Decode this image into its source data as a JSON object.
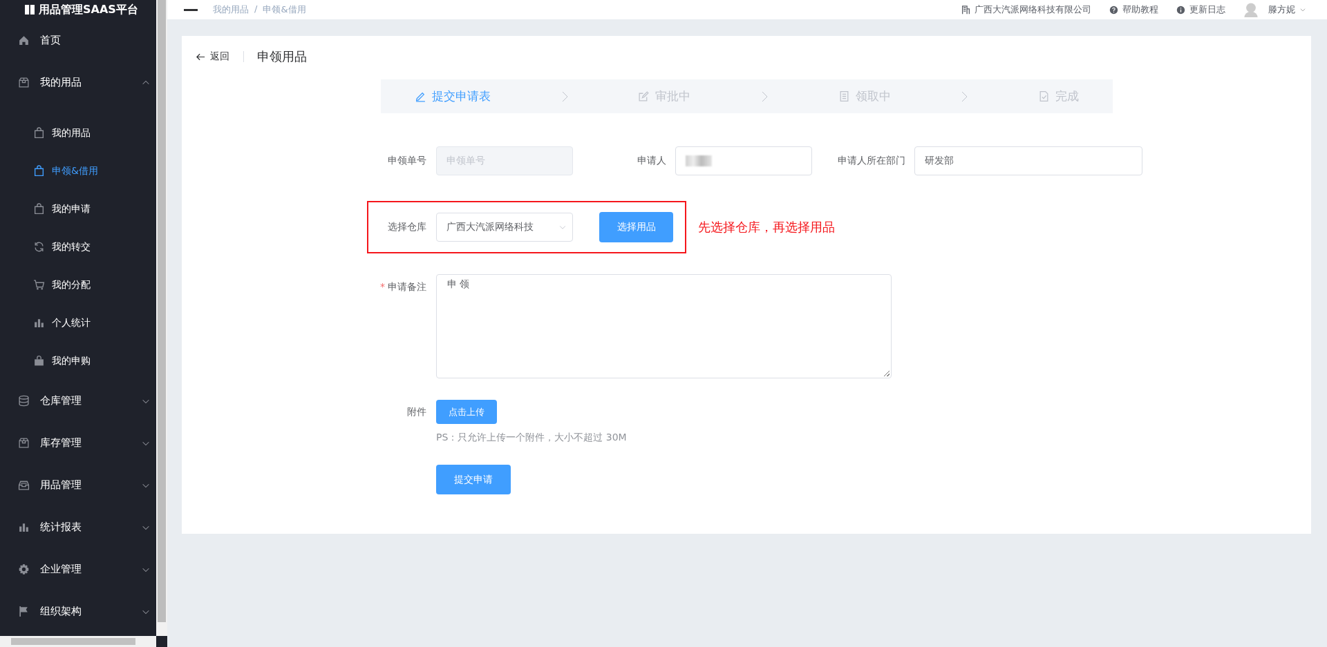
{
  "app": {
    "logo": "用品管理SAAS平台"
  },
  "header": {
    "breadcrumb": [
      "我的用品",
      "申领&借用"
    ],
    "separator": "/",
    "company": "广西大汽派网络科技有限公司",
    "links": [
      {
        "label": "帮助教程",
        "kind": "help"
      },
      {
        "label": "更新日志",
        "kind": "info"
      }
    ],
    "user": "滕方妮"
  },
  "sidebar": {
    "items": [
      {
        "label": "首页",
        "kind": "home"
      },
      {
        "label": "我的用品",
        "kind": "box",
        "expanded": true,
        "children": [
          {
            "label": "我的用品",
            "kind": "bag",
            "selected": false
          },
          {
            "label": "申领&借用",
            "kind": "bag",
            "selected": true
          },
          {
            "label": "我的申请",
            "kind": "bag",
            "selected": false
          },
          {
            "label": "我的转交",
            "kind": "refresh",
            "selected": false
          },
          {
            "label": "我的分配",
            "kind": "cart",
            "selected": false
          },
          {
            "label": "个人统计",
            "kind": "bars",
            "selected": false
          },
          {
            "label": "我的申购",
            "kind": "bagsolid",
            "selected": false
          }
        ]
      },
      {
        "label": "仓库管理",
        "kind": "database",
        "expanded": false
      },
      {
        "label": "库存管理",
        "kind": "box",
        "expanded": false
      },
      {
        "label": "用品管理",
        "kind": "inbox",
        "expanded": false
      },
      {
        "label": "统计报表",
        "kind": "bars",
        "expanded": false
      },
      {
        "label": "企业管理",
        "kind": "gear",
        "expanded": false
      },
      {
        "label": "组织架构",
        "kind": "flag",
        "expanded": false
      }
    ]
  },
  "page": {
    "back": "返回",
    "title": "申领用品"
  },
  "steps": [
    {
      "label": "提交申请表",
      "kind": "pen",
      "selected": true
    },
    {
      "label": "审批中",
      "kind": "edit",
      "selected": false
    },
    {
      "label": "领取中",
      "kind": "doc",
      "selected": false
    },
    {
      "label": "完成",
      "kind": "check",
      "selected": false
    }
  ],
  "form": {
    "fields": [
      {
        "label": "申领单号",
        "kind": "input",
        "placeholder": "申领单号",
        "disabled": true
      },
      {
        "label": "申请人",
        "kind": "blurred",
        "disabled": false
      },
      {
        "label": "申请人所在部门",
        "kind": "input",
        "value": "研发部",
        "disabled": false
      }
    ],
    "warehouse": {
      "label": "选择仓库",
      "value": "广西大汽派网络科技",
      "button": "选择用品",
      "note": "先选择仓库，再选择用品"
    },
    "remark": {
      "label": "申请备注",
      "required_mark": "*",
      "value": "申 领"
    },
    "attachment": {
      "label": "附件",
      "button": "点击上传",
      "hint": "PS：只允许上传一个附件，大小不超过 30M"
    },
    "submit": "提交申请"
  }
}
